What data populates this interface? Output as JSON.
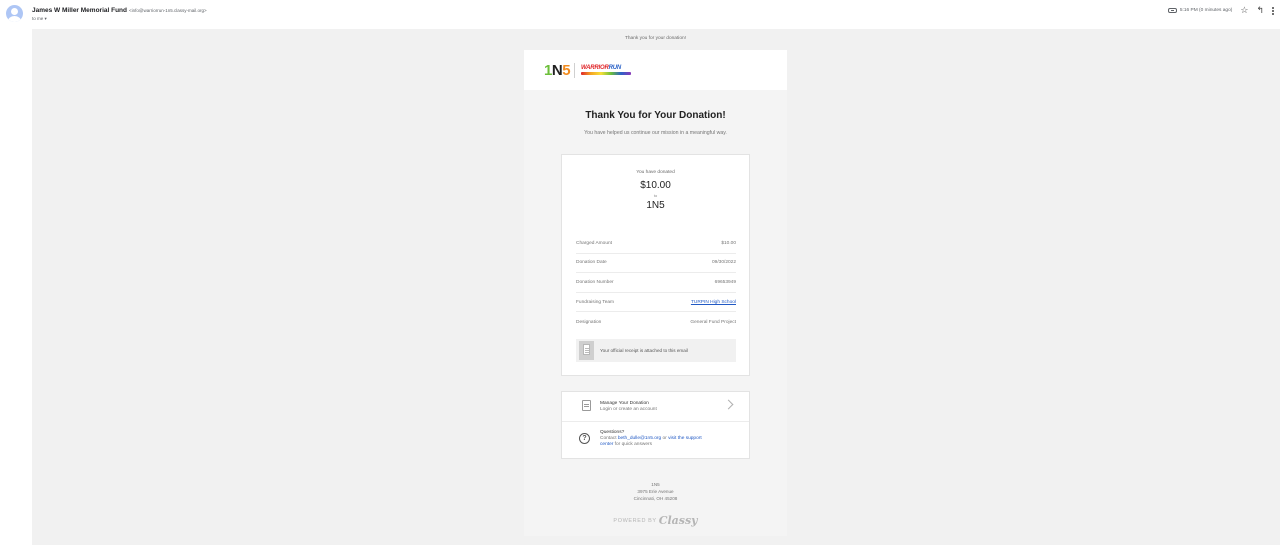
{
  "header": {
    "sender_name": "James W Miller Memorial Fund",
    "sender_email": "<info@warriorrun-1n5.classy-mail.org>",
    "to_label": "to me ▾",
    "timestamp": "5:16 PM (0 minutes ago)",
    "icons": [
      "attachment-icon",
      "star-icon",
      "reply-icon",
      "more-vert-icon"
    ]
  },
  "email": {
    "preheader": "Thank you for your donation!",
    "logo": {
      "primary_1": "1",
      "primary_2": "N",
      "primary_3": "5",
      "secondary_1": "WARRIOR",
      "secondary_2": "RUN"
    },
    "title": "Thank You for Your Donation!",
    "subtitle": "You have helped us continue our mission in a meaningful way.",
    "summary": {
      "donated_label": "You have donated",
      "amount": "$10.00",
      "to_label": "to",
      "org": "1N5"
    },
    "details": [
      {
        "label": "Charged Amount",
        "value": "$10.00"
      },
      {
        "label": "Donation Date",
        "value": "09/30/2022"
      },
      {
        "label": "Donation Number",
        "value": "69653949"
      },
      {
        "label": "Fundraising Team",
        "value": "TURPIN High School"
      },
      {
        "label": "Designation",
        "value": "General Fund Project"
      }
    ],
    "receipt_note": "Your official receipt is attached to this email",
    "manage": {
      "title": "Manage Your Donation",
      "subtitle": "Login or create an account"
    },
    "questions": {
      "title": "Questions?",
      "contact_prefix": "Contact ",
      "contact_email": "beth_dulle@1n5.org",
      "contact_or": " or ",
      "support_link_1": "visit the support",
      "support_link_2": "center",
      "contact_suffix": " for quick answers"
    },
    "footer": {
      "org": "1N5",
      "address_1": "3975 Erie Avenue",
      "address_2": "Cincinnati, OH 45208",
      "powered_by": "POWERED BY",
      "brand": "Classy"
    }
  },
  "colors": {
    "link": "#2159c4",
    "background": "#f1f1f1",
    "logo_green": "#6cbf3a",
    "logo_orange": "#f28c1f",
    "logo_red": "#e0262a"
  }
}
